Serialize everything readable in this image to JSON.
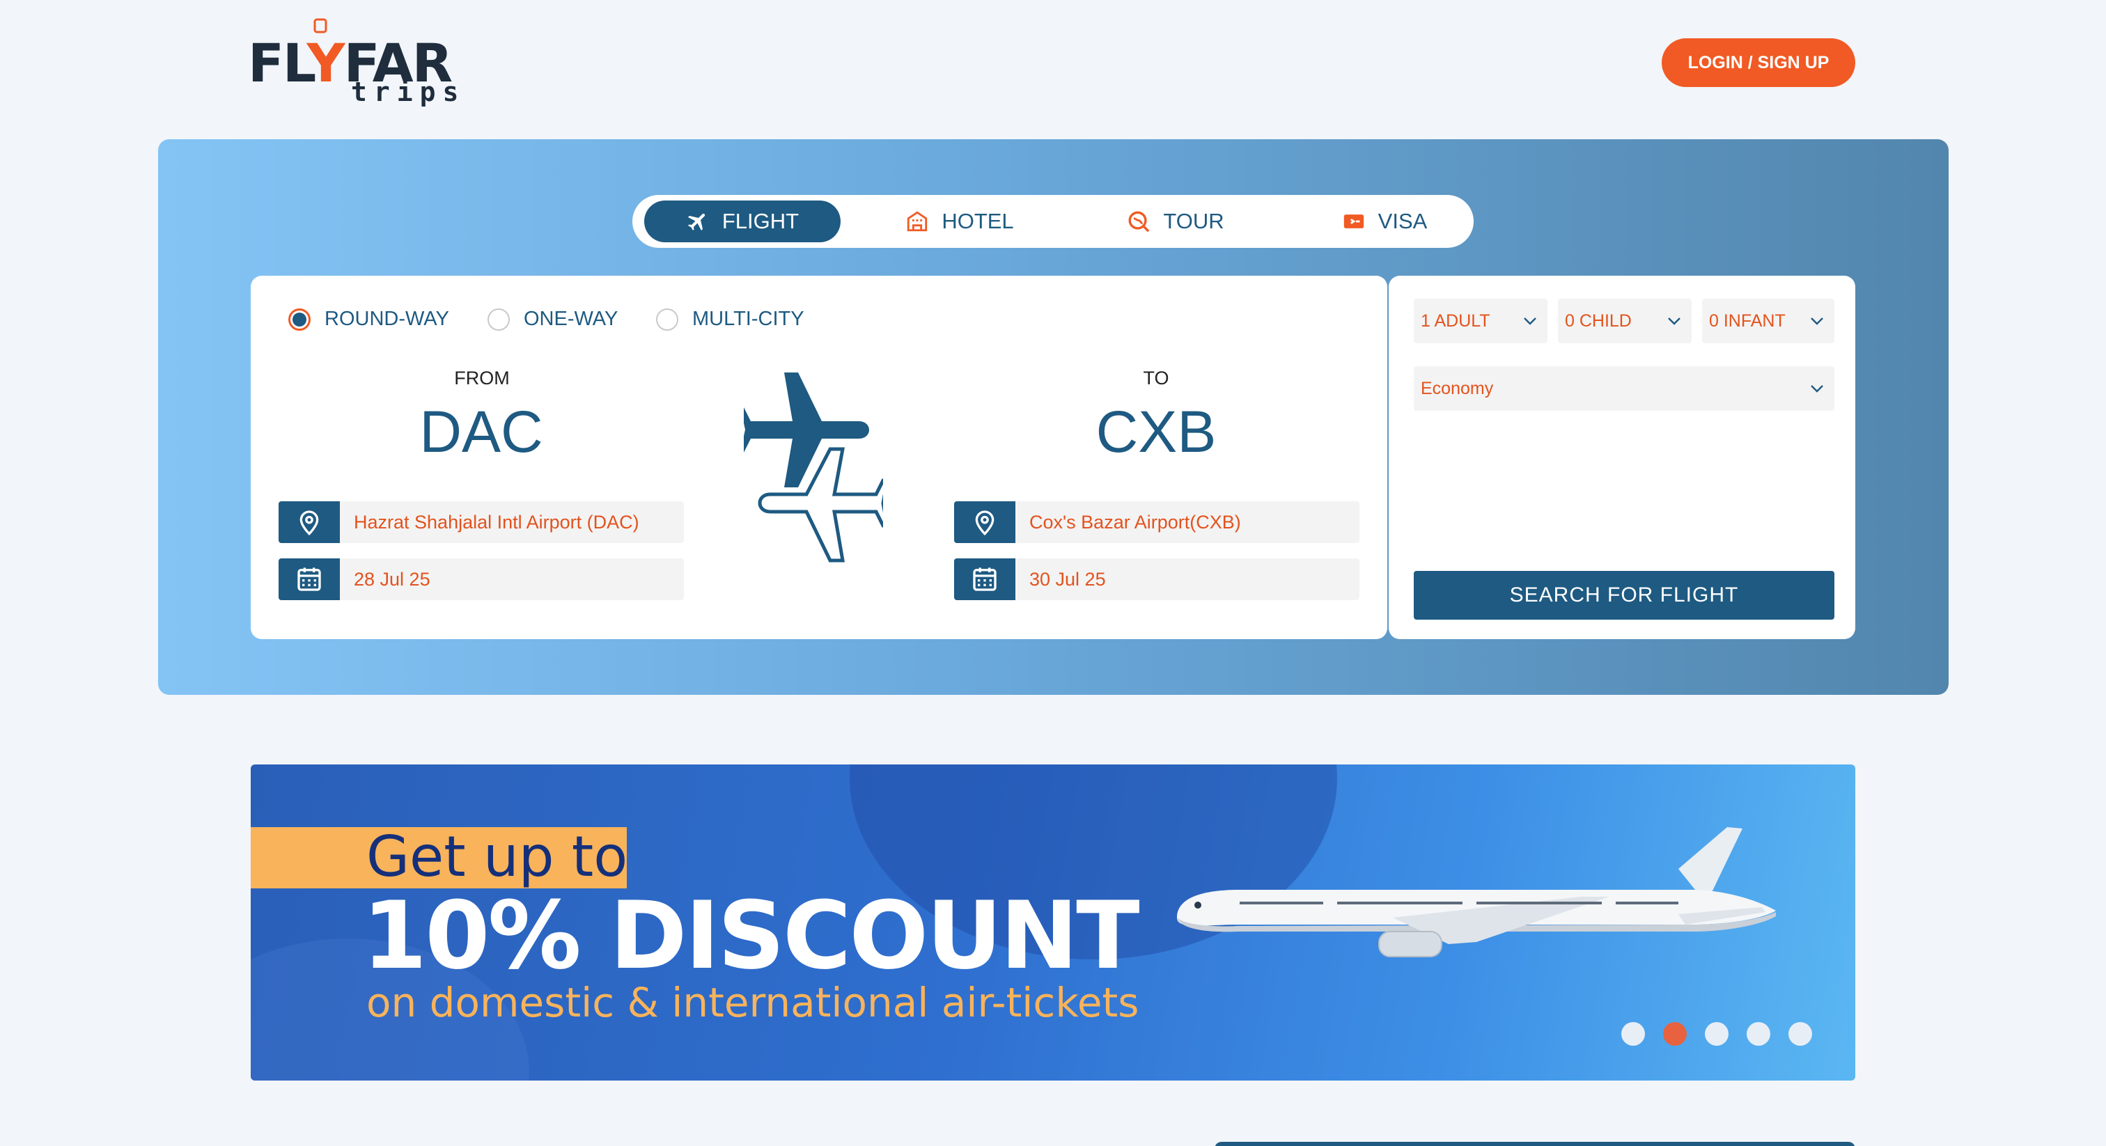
{
  "header": {
    "logo_main_left": "FL",
    "logo_main_y": "Y",
    "logo_main_right": "FAR",
    "logo_sub": "trips",
    "login_label": "LOGIN / SIGN UP"
  },
  "tabs": [
    {
      "label": "FLIGHT",
      "icon": "airplane-icon",
      "active": true
    },
    {
      "label": "HOTEL",
      "icon": "hotel-icon",
      "active": false
    },
    {
      "label": "TOUR",
      "icon": "tour-icon",
      "active": false
    },
    {
      "label": "VISA",
      "icon": "visa-icon",
      "active": false
    }
  ],
  "trip_types": [
    {
      "label": "ROUND-WAY",
      "selected": true
    },
    {
      "label": "ONE-WAY",
      "selected": false
    },
    {
      "label": "MULTI-CITY",
      "selected": false
    }
  ],
  "from": {
    "label": "FROM",
    "code": "DAC",
    "airport": "Hazrat Shahjalal Intl Airport (DAC)",
    "date": "28 Jul 25"
  },
  "to": {
    "label": "TO",
    "code": "CXB",
    "airport": "Cox's Bazar Airport(CXB)",
    "date": "30 Jul 25"
  },
  "passengers": {
    "adult": "1 ADULT",
    "child": "0 CHILD",
    "infant": "0 INFANT",
    "cabin_class": "Economy"
  },
  "search_button": "SEARCH FOR FLIGHT",
  "banner": {
    "line1": "Get up to",
    "line2": "10% DISCOUNT",
    "line3": "on domestic & international air-tickets",
    "active_slide": 2,
    "slide_count": 5
  },
  "colors": {
    "primary": "#1e5a82",
    "accent": "#f15a24",
    "banner_highlight": "#f8b35b"
  }
}
